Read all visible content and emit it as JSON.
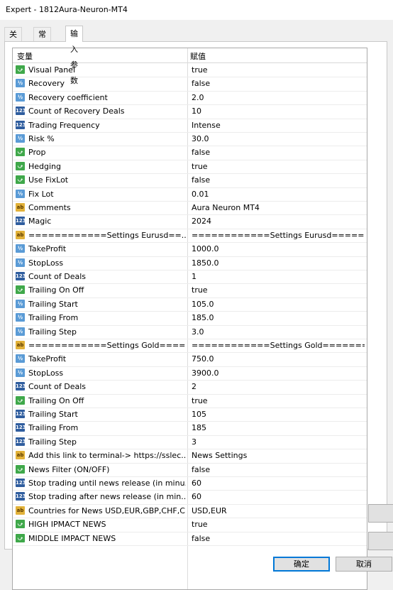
{
  "window": {
    "title": "Expert - 1812Aura-Neuron-MT4"
  },
  "tabs": [
    {
      "label": "关于"
    },
    {
      "label": "常用"
    },
    {
      "label": "输入参数"
    }
  ],
  "table": {
    "col_variable": "变量",
    "col_value": "赋值",
    "rows": [
      {
        "type": "bool",
        "icon": "bool-icon",
        "name": "Visual Panel",
        "value": "true"
      },
      {
        "type": "dbl",
        "icon": "double-icon",
        "name": "Recovery",
        "value": "false"
      },
      {
        "type": "dbl",
        "icon": "double-icon",
        "name": "Recovery coefficient",
        "value": "2.0"
      },
      {
        "type": "int",
        "icon": "int-icon",
        "name": "Count of Recovery Deals",
        "value": "10"
      },
      {
        "type": "int",
        "icon": "int-icon",
        "name": "Trading Frequency",
        "value": "Intense"
      },
      {
        "type": "dbl",
        "icon": "double-icon",
        "name": "Risk %",
        "value": "30.0"
      },
      {
        "type": "bool",
        "icon": "bool-icon",
        "name": "Prop",
        "value": "false"
      },
      {
        "type": "bool",
        "icon": "bool-icon",
        "name": "Hedging",
        "value": "true"
      },
      {
        "type": "bool",
        "icon": "bool-icon",
        "name": "Use FixLot",
        "value": "false"
      },
      {
        "type": "dbl",
        "icon": "double-icon",
        "name": "Fix Lot",
        "value": "0.01"
      },
      {
        "type": "str",
        "icon": "string-icon",
        "name": "Comments",
        "value": "Aura Neuron MT4"
      },
      {
        "type": "int",
        "icon": "int-icon",
        "name": "Magic",
        "value": "2024"
      },
      {
        "type": "str",
        "icon": "string-icon",
        "name": "============Settings Eurusd==...",
        "value": "============Settings Eurusd=====..."
      },
      {
        "type": "dbl",
        "icon": "double-icon",
        "name": "TakeProfit",
        "value": "1000.0"
      },
      {
        "type": "dbl",
        "icon": "double-icon",
        "name": "StopLoss",
        "value": "1850.0"
      },
      {
        "type": "int",
        "icon": "int-icon",
        "name": "Count of Deals",
        "value": "1"
      },
      {
        "type": "bool",
        "icon": "bool-icon",
        "name": "Trailing On Off",
        "value": "true"
      },
      {
        "type": "dbl",
        "icon": "double-icon",
        "name": "Trailing Start",
        "value": "105.0"
      },
      {
        "type": "dbl",
        "icon": "double-icon",
        "name": "Trailing From",
        "value": "185.0"
      },
      {
        "type": "dbl",
        "icon": "double-icon",
        "name": "Trailing Step",
        "value": "3.0"
      },
      {
        "type": "str",
        "icon": "string-icon",
        "name": "============Settings Gold====...",
        "value": "============Settings Gold=======..."
      },
      {
        "type": "dbl",
        "icon": "double-icon",
        "name": "TakeProfit",
        "value": "750.0"
      },
      {
        "type": "dbl",
        "icon": "double-icon",
        "name": "StopLoss",
        "value": "3900.0"
      },
      {
        "type": "int",
        "icon": "int-icon",
        "name": "Count of Deals",
        "value": "2"
      },
      {
        "type": "bool",
        "icon": "bool-icon",
        "name": "Trailing On Off",
        "value": "true"
      },
      {
        "type": "int",
        "icon": "int-icon",
        "name": "Trailing Start",
        "value": "105"
      },
      {
        "type": "int",
        "icon": "int-icon",
        "name": "Trailing From",
        "value": "185"
      },
      {
        "type": "int",
        "icon": "int-icon",
        "name": "Trailing Step",
        "value": "3"
      },
      {
        "type": "str",
        "icon": "string-icon",
        "name": "Add this link to terminal-> https://sslec...",
        "value": "News Settings"
      },
      {
        "type": "bool",
        "icon": "bool-icon",
        "name": "News Filter (ON/OFF)",
        "value": "false"
      },
      {
        "type": "int",
        "icon": "int-icon",
        "name": "Stop trading until news release (in minu...",
        "value": "60"
      },
      {
        "type": "int",
        "icon": "int-icon",
        "name": "Stop trading after news release (in min...",
        "value": "60"
      },
      {
        "type": "str",
        "icon": "string-icon",
        "name": "Countries for News USD,EUR,GBP,CHF,C...",
        "value": "USD,EUR"
      },
      {
        "type": "bool",
        "icon": "bool-icon",
        "name": "HIGH IPMACT NEWS",
        "value": "true"
      },
      {
        "type": "bool",
        "icon": "bool-icon",
        "name": "MIDDLE IMPACT NEWS",
        "value": "false"
      }
    ]
  },
  "buttons": {
    "ok": "确定",
    "cancel": "取消"
  },
  "icon_glyphs": {
    "bool": "⤻",
    "dbl": "½",
    "int": "123",
    "str": "ab"
  }
}
